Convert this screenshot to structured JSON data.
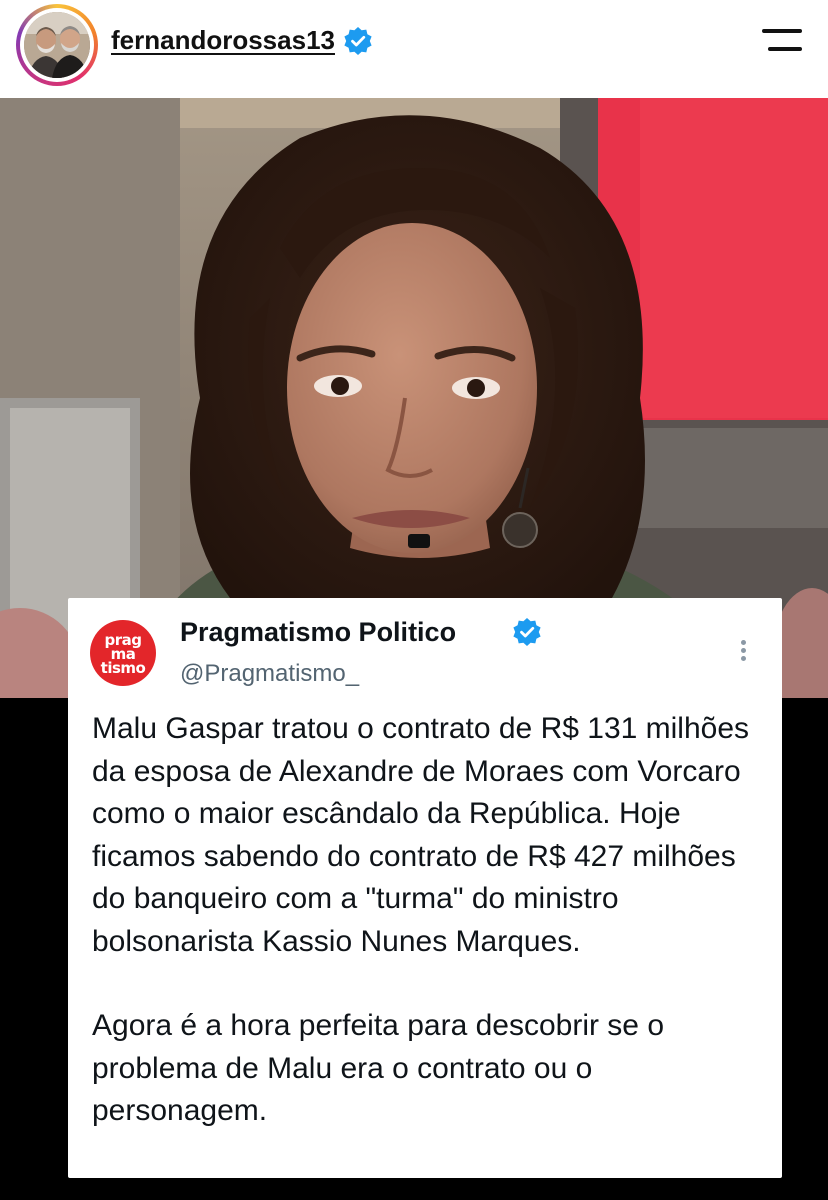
{
  "header": {
    "username": "fernandorossas13",
    "verified_icon": "verified-badge-icon",
    "menu_icon": "hamburger-menu-icon"
  },
  "tweet": {
    "display_name": "Pragmatismo Politico",
    "handle": "@Pragmatismo_",
    "avatar_logo_lines": [
      "prag",
      "ma",
      "tismo"
    ],
    "more_icon": "more-vertical-icon",
    "paragraphs": [
      "Malu Gaspar tratou o contrato de R$ 131 milhões da esposa de Alexandre de Moraes com Vorcaro como o maior escândalo da República. Hoje ficamos sabendo do contrato de R$ 427 milhões do banqueiro com a \"turma\" do ministro bolsonarista Kassio Nunes Marques.",
      "Agora é a hora perfeita para descobrir se o problema de Malu era o contrato ou o personagem."
    ]
  },
  "colors": {
    "verified_blue": "#1d9bf0",
    "logo_red": "#e3262a",
    "studio_red": "#e8334a"
  }
}
